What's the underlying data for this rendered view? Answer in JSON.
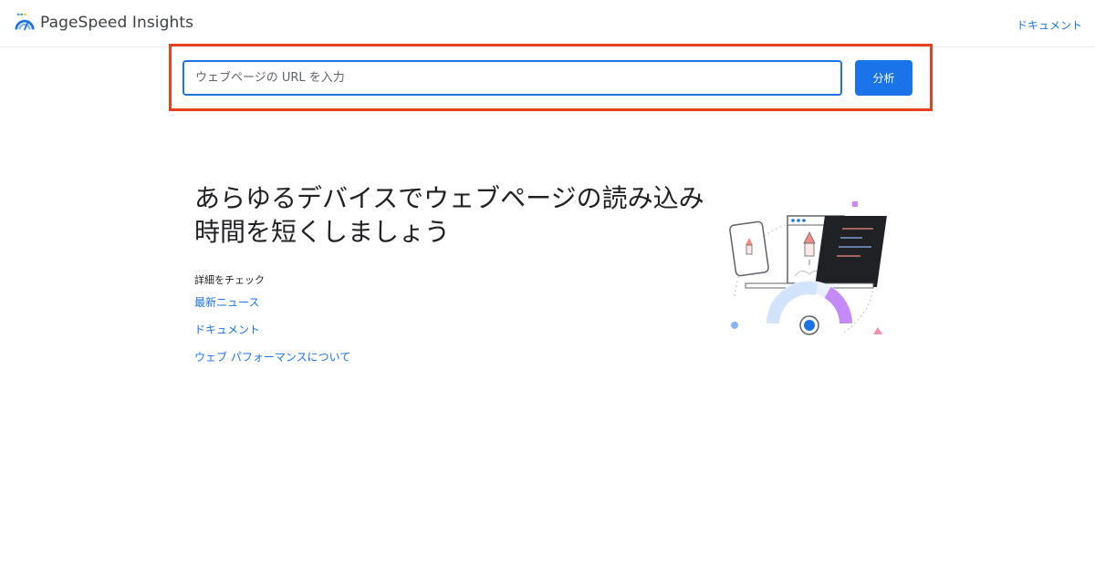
{
  "header": {
    "brand": "PageSpeed Insights",
    "logo_icon": "pagespeed-gauge-icon",
    "docs_link": "ドキュメント"
  },
  "search": {
    "placeholder": "ウェブページの URL を入力",
    "value": "",
    "button_label": "分析",
    "highlight_color": "#e8401c"
  },
  "main": {
    "headline": "あらゆるデバイスでウェブページの読み込み時間を短くしましょう",
    "section_label": "詳細をチェック",
    "links": [
      {
        "label": "最新ニュース"
      },
      {
        "label": "ドキュメント"
      },
      {
        "label": "ウェブ パフォーマンスについて"
      }
    ]
  },
  "illustration": {
    "icon": "rocket-devices-gauge-illustration"
  },
  "colors": {
    "accent": "#1a73e8",
    "text": "#202124",
    "highlight": "#e8401c"
  }
}
